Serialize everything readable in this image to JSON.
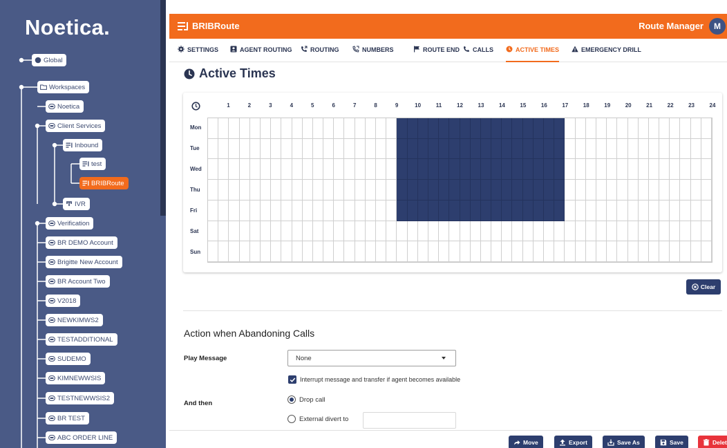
{
  "sidebar": {
    "logo": "Noetica.",
    "tree": [
      {
        "label": "Global",
        "icon": "globe-icon"
      },
      {
        "label": "Workspaces",
        "icon": "folder-icon"
      },
      {
        "label": "Noetica",
        "icon": "account-icon"
      },
      {
        "label": "Client Services",
        "icon": "account-icon"
      },
      {
        "label": "Inbound",
        "icon": "route-icon"
      },
      {
        "label": "test",
        "icon": "route-icon"
      },
      {
        "label": "BRIBRoute",
        "icon": "route-icon",
        "active": true
      },
      {
        "label": "IVR",
        "icon": "ivr-icon"
      },
      {
        "label": "Verification",
        "icon": "account-icon"
      },
      {
        "label": "BR DEMO Account",
        "icon": "account-icon"
      },
      {
        "label": "Brigitte New Account",
        "icon": "account-icon"
      },
      {
        "label": "BR Account Two",
        "icon": "account-icon"
      },
      {
        "label": "V2018",
        "icon": "account-icon"
      },
      {
        "label": "NEWKIMWS2",
        "icon": "account-icon"
      },
      {
        "label": "TESTADDITIONAL",
        "icon": "account-icon"
      },
      {
        "label": "SUDEMO",
        "icon": "account-icon"
      },
      {
        "label": "KIMNEWWSIS",
        "icon": "account-icon"
      },
      {
        "label": "TESTNEWWSIS2",
        "icon": "account-icon"
      },
      {
        "label": "BR TEST",
        "icon": "account-icon"
      },
      {
        "label": "ABC ORDER LINE",
        "icon": "account-icon"
      }
    ]
  },
  "header": {
    "route_name": "BRIBRoute",
    "role": "Route Manager",
    "avatar_initial": "M"
  },
  "tabs": [
    {
      "label": "SETTINGS",
      "icon": "gear-icon"
    },
    {
      "label": "AGENT ROUTING",
      "icon": "agent-icon"
    },
    {
      "label": "ROUTING",
      "icon": "phone-forward-icon"
    },
    {
      "label": "NUMBERS",
      "icon": "phone-numbers-icon"
    },
    {
      "label": "ROUTE END",
      "icon": "flag-icon"
    },
    {
      "label": "CALLS",
      "icon": "phone-icon"
    },
    {
      "label": "ACTIVE TIMES",
      "icon": "clock-icon",
      "active": true
    },
    {
      "label": "EMERGENCY DRILL",
      "icon": "warning-icon"
    }
  ],
  "active_times": {
    "title": "Active Times",
    "hours": [
      "1",
      "2",
      "3",
      "4",
      "5",
      "6",
      "7",
      "8",
      "9",
      "10",
      "11",
      "12",
      "13",
      "14",
      "15",
      "16",
      "17",
      "18",
      "19",
      "20",
      "21",
      "22",
      "23",
      "24"
    ],
    "days": [
      "Mon",
      "Tue",
      "Wed",
      "Thu",
      "Fri",
      "Sat",
      "Sun"
    ],
    "active_days": [
      "Mon",
      "Tue",
      "Wed",
      "Thu",
      "Fri"
    ],
    "active_from_hour": 9,
    "active_to_hour": 17,
    "clear_label": "Clear"
  },
  "abandon": {
    "title": "Action when Abandoning Calls",
    "play_message_label": "Play Message",
    "play_message_value": "None",
    "interrupt_label": "Interrupt message and transfer if agent becomes available",
    "interrupt_checked": true,
    "and_then_label": "And then",
    "options": [
      {
        "label": "Drop call",
        "selected": true
      },
      {
        "label": "External divert to",
        "selected": false
      }
    ],
    "divert_value": ""
  },
  "footer": {
    "buttons": [
      {
        "label": "Move",
        "icon": "move-icon"
      },
      {
        "label": "Export",
        "icon": "export-icon"
      },
      {
        "label": "Save As",
        "icon": "save-as-icon"
      },
      {
        "label": "Save",
        "icon": "save-icon"
      },
      {
        "label": "Delet",
        "icon": "delete-icon"
      }
    ]
  },
  "colors": {
    "brand_orange": "#f26b1d",
    "navy": "#2d3e6e",
    "sidebar_bg": "#4a5a86",
    "danger": "#e8333b"
  }
}
